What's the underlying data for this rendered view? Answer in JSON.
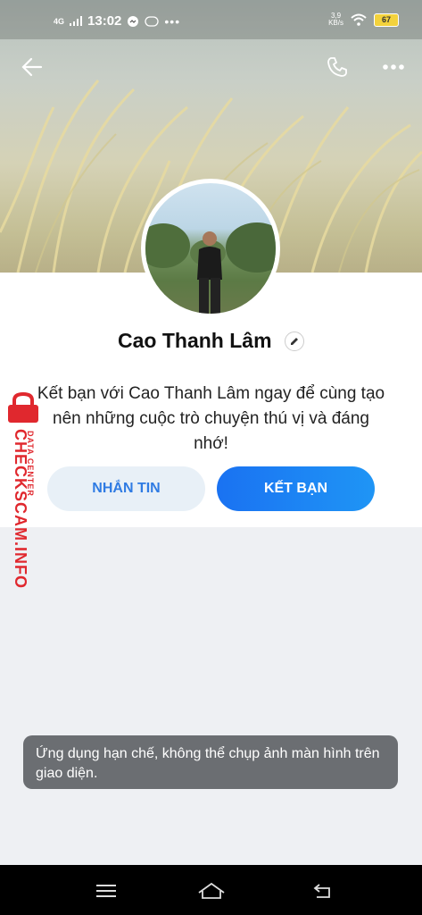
{
  "status_bar": {
    "network": "4G",
    "time": "13:02",
    "speed_value": "3,9",
    "speed_unit": "KB/s",
    "battery": "67"
  },
  "header": {
    "back_icon": "arrow-left-icon",
    "call_icon": "phone-icon",
    "more_icon": "more-horizontal-icon"
  },
  "profile": {
    "name": "Cao Thanh Lâm",
    "edit_icon": "pencil-icon"
  },
  "friend_card": {
    "invite_text": "Kết bạn với Cao Thanh Lâm ngay để cùng tạo nên những cuộc trò chuyện thú vị và đáng nhớ!",
    "message_button": "NHẮN TIN",
    "add_friend_button": "KẾT BẠN"
  },
  "watermark": {
    "sub": "DATA CENTER",
    "main": "CHECKSCAM.INFO"
  },
  "toast": {
    "text": "Ứng dụng hạn chế, không thể chụp ảnh màn hình trên giao diện."
  },
  "nav_bar": {
    "menu_icon": "menu-icon",
    "home_icon": "home-icon",
    "back_icon": "return-icon"
  },
  "colors": {
    "accent": "#1a72f2",
    "watermark": "#e0282e",
    "toast_bg": "#6b6e72"
  }
}
